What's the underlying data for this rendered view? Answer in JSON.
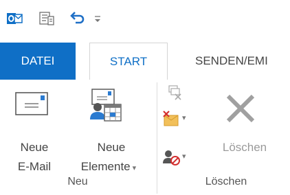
{
  "qat": {
    "app_icon": "outlook-icon",
    "send_receive_icon": "send-receive-all-icon",
    "undo_icon": "undo-icon",
    "customize_icon": "customize-qat-icon"
  },
  "tabs": [
    {
      "label": "DATEI"
    },
    {
      "label": "START"
    },
    {
      "label": "SENDEN/EMI"
    }
  ],
  "groups": {
    "neu": {
      "label": "Neu",
      "new_email": {
        "line1": "Neue",
        "line2": "E-Mail"
      },
      "new_items": {
        "line1": "Neue",
        "line2": "Elemente"
      }
    },
    "loeschen": {
      "label": "Löschen",
      "delete_label": "Löschen"
    }
  },
  "colors": {
    "accent": "#0f6fc6",
    "tab_text": "#0f6fc6"
  }
}
